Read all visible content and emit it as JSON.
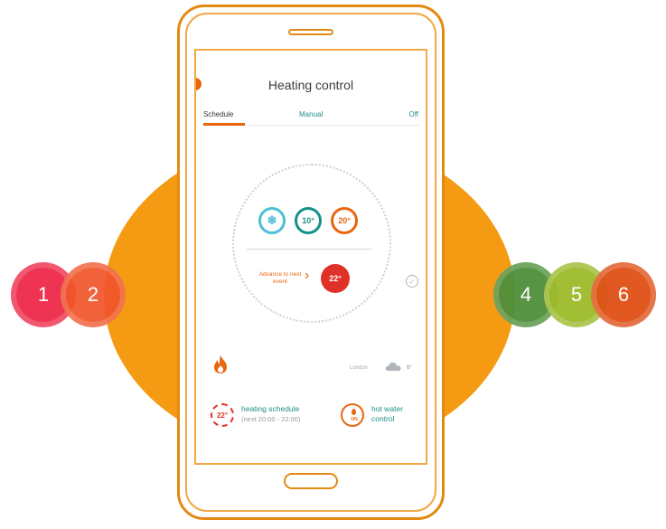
{
  "app": {
    "title": "Heating control"
  },
  "tabs": [
    {
      "label": "Schedule",
      "active": true
    },
    {
      "label": "Manual",
      "active": false
    },
    {
      "label": "Off",
      "active": false
    }
  ],
  "modes": [
    {
      "icon": "snowflake-icon",
      "label": "❄"
    },
    {
      "label": "10°"
    },
    {
      "label": "20°"
    }
  ],
  "advance": {
    "label": "Advance to next event",
    "current_temp": "22°"
  },
  "weather": {
    "city": "London",
    "temp": "6°",
    "icon": "cloud-icon"
  },
  "schedule_card": {
    "ring": "22°",
    "title": "heating schedule",
    "subtitle": "(next 20:00 - 22:00)"
  },
  "hot_water_card": {
    "icon_text": "ON",
    "title": "hot water control"
  },
  "callouts": [
    "1",
    "2",
    "4",
    "5",
    "6"
  ],
  "colors": {
    "accent_orange": "#f59b13",
    "accent_red": "#e03128",
    "teal": "#1f8f8a",
    "bubble_1": "#ee2a49",
    "bubble_2": "#f1552a",
    "bubble_4": "#4f8f3a",
    "bubble_5": "#9cbb2a",
    "bubble_6": "#e05016"
  }
}
